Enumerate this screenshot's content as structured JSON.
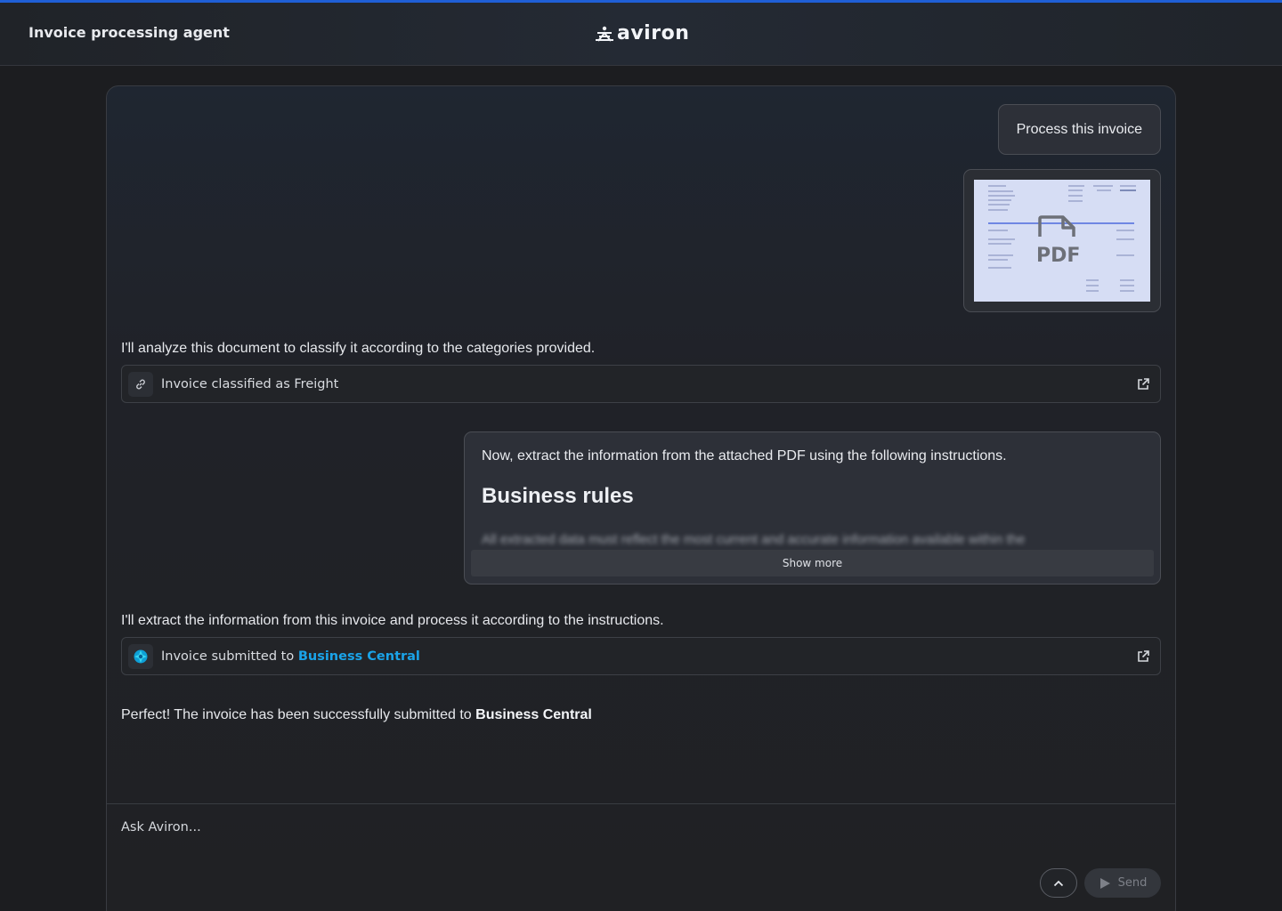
{
  "header": {
    "title": "Invoice processing agent",
    "logo_text": "aviron"
  },
  "messages": {
    "user_prompt": "Process this invoice",
    "attachment": {
      "type_label": "PDF"
    },
    "agent_classify": "I'll analyze this document to classify it according to the categories provided.",
    "tool_classified": {
      "label": "Invoice classified as Freight",
      "icon": "link-icon"
    },
    "user_extract": {
      "intro": "Now, extract the information from the attached PDF using the following instructions.",
      "heading": "Business rules",
      "preview": "All extracted data must reflect the most current and accurate information available within the",
      "show_more": "Show more"
    },
    "agent_extract": "I'll extract the information from this invoice and process it according to the instructions.",
    "tool_submitted": {
      "label_prefix": "Invoice submitted to ",
      "link": "Business Central",
      "icon": "business-central-icon"
    },
    "agent_final": {
      "prefix": "Perfect! The invoice has been successfully submitted to ",
      "emphasis": "Business Central"
    }
  },
  "composer": {
    "placeholder": "Ask Aviron...",
    "send_label": "Send"
  },
  "colors": {
    "accent_line": "#1f5fd6",
    "link": "#1aa3e8",
    "background": "#1c1d20"
  }
}
